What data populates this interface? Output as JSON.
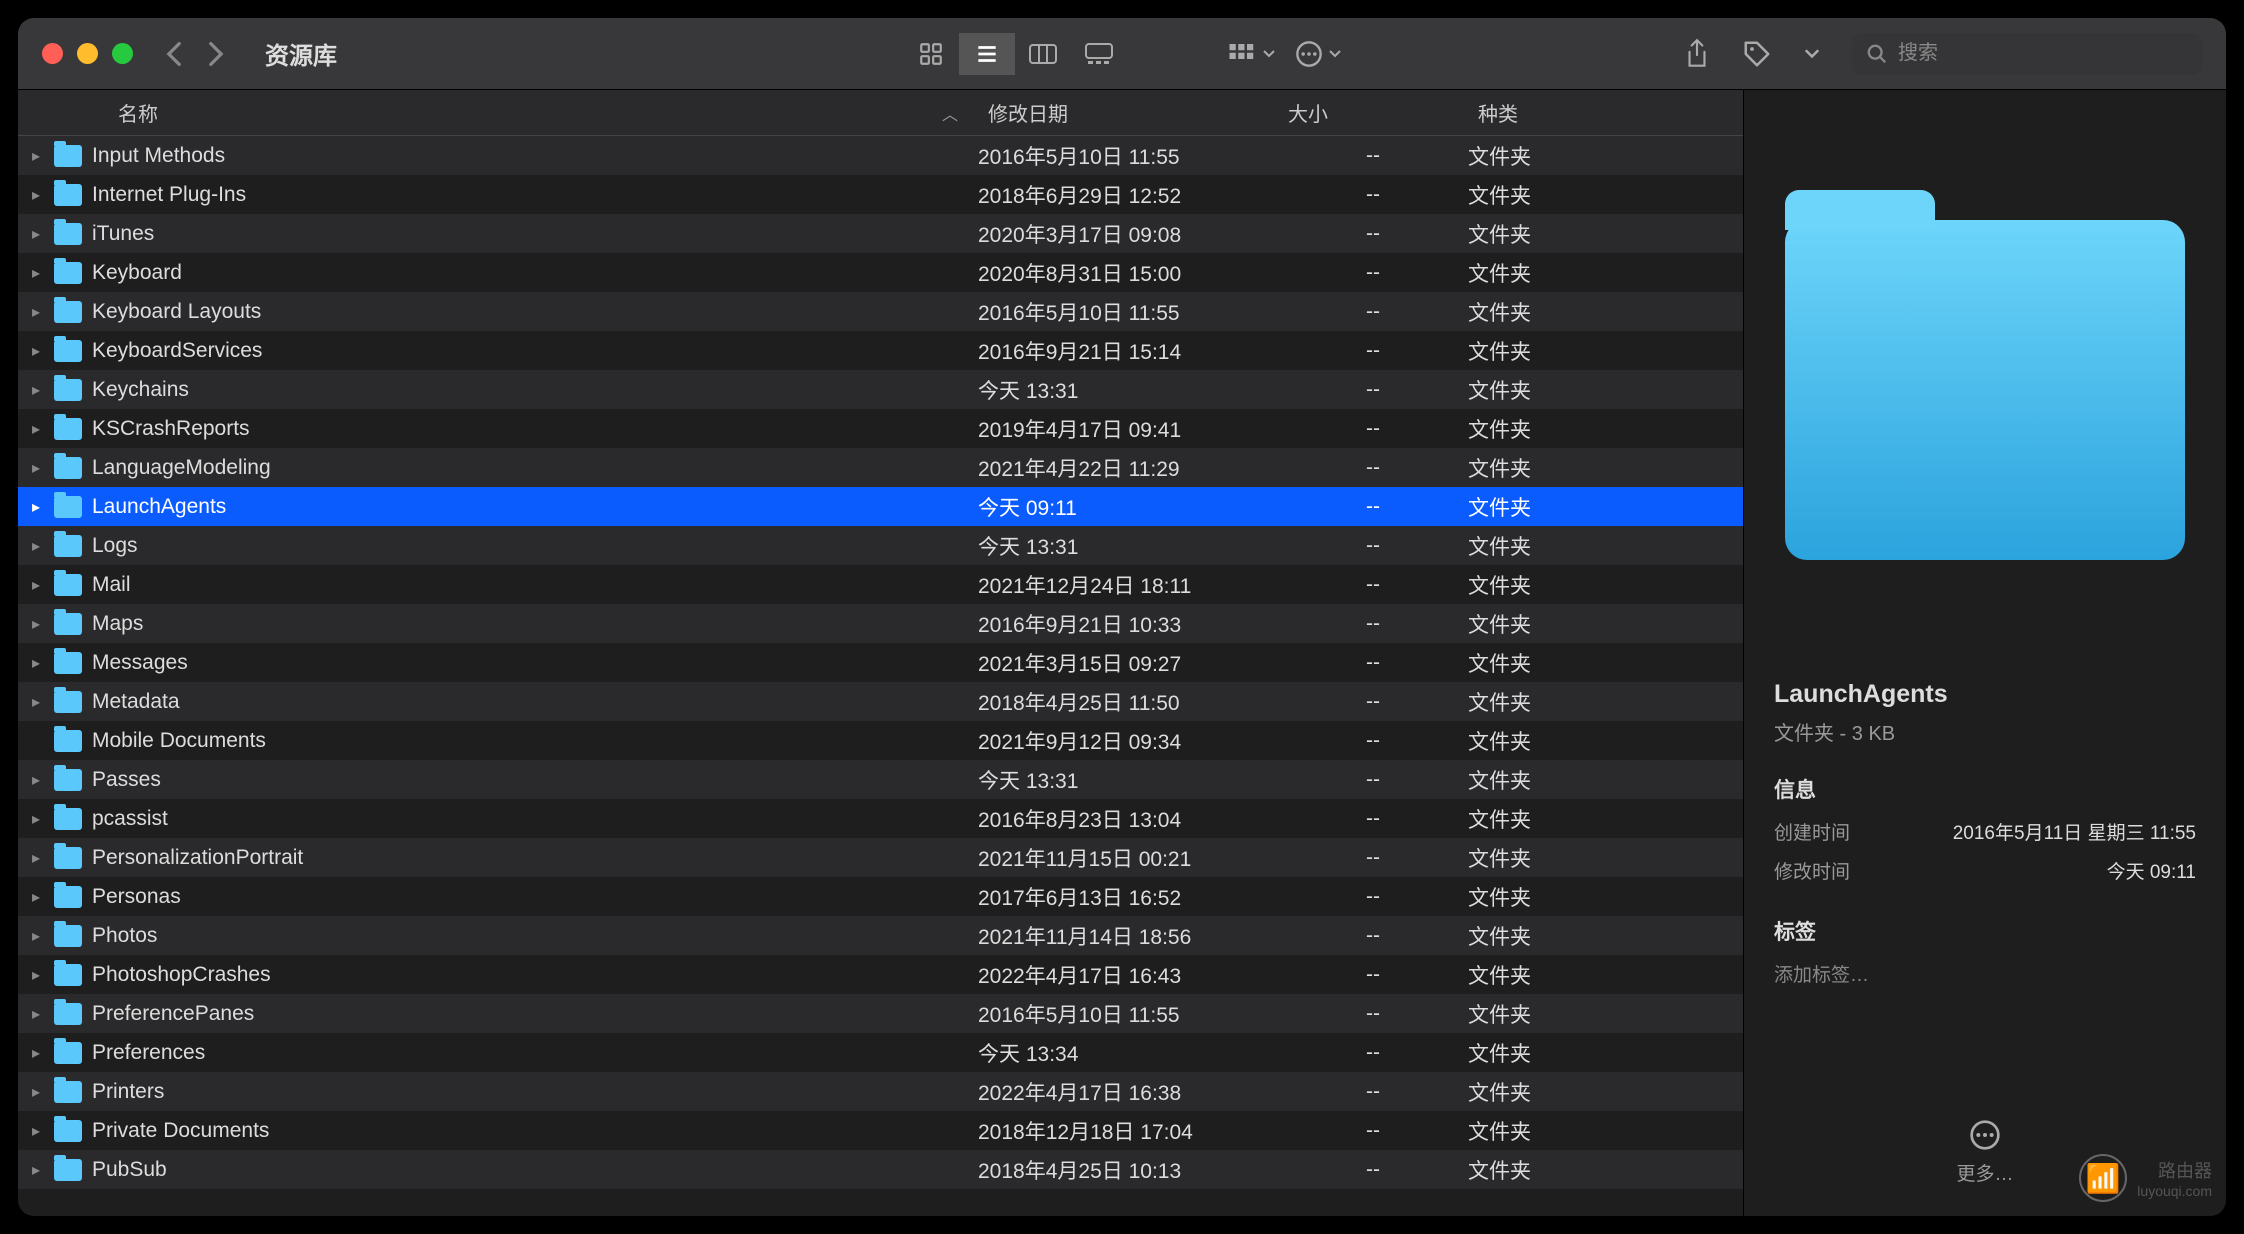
{
  "window": {
    "title": "资源库"
  },
  "search": {
    "placeholder": "搜索"
  },
  "columns": {
    "name": "名称",
    "date": "修改日期",
    "size": "大小",
    "kind": "种类"
  },
  "selected_index": 9,
  "items": [
    {
      "name": "Input Methods",
      "date": "2016年5月10日 11:55",
      "size": "--",
      "kind": "文件夹",
      "chev": true
    },
    {
      "name": "Internet Plug-Ins",
      "date": "2018年6月29日 12:52",
      "size": "--",
      "kind": "文件夹",
      "chev": true
    },
    {
      "name": "iTunes",
      "date": "2020年3月17日 09:08",
      "size": "--",
      "kind": "文件夹",
      "chev": true
    },
    {
      "name": "Keyboard",
      "date": "2020年8月31日 15:00",
      "size": "--",
      "kind": "文件夹",
      "chev": true
    },
    {
      "name": "Keyboard Layouts",
      "date": "2016年5月10日 11:55",
      "size": "--",
      "kind": "文件夹",
      "chev": true
    },
    {
      "name": "KeyboardServices",
      "date": "2016年9月21日 15:14",
      "size": "--",
      "kind": "文件夹",
      "chev": true
    },
    {
      "name": "Keychains",
      "date": "今天 13:31",
      "size": "--",
      "kind": "文件夹",
      "chev": true
    },
    {
      "name": "KSCrashReports",
      "date": "2019年4月17日 09:41",
      "size": "--",
      "kind": "文件夹",
      "chev": true
    },
    {
      "name": "LanguageModeling",
      "date": "2021年4月22日 11:29",
      "size": "--",
      "kind": "文件夹",
      "chev": true
    },
    {
      "name": "LaunchAgents",
      "date": "今天 09:11",
      "size": "--",
      "kind": "文件夹",
      "chev": true
    },
    {
      "name": "Logs",
      "date": "今天 13:31",
      "size": "--",
      "kind": "文件夹",
      "chev": true
    },
    {
      "name": "Mail",
      "date": "2021年12月24日 18:11",
      "size": "--",
      "kind": "文件夹",
      "chev": true
    },
    {
      "name": "Maps",
      "date": "2016年9月21日 10:33",
      "size": "--",
      "kind": "文件夹",
      "chev": true
    },
    {
      "name": "Messages",
      "date": "2021年3月15日 09:27",
      "size": "--",
      "kind": "文件夹",
      "chev": true
    },
    {
      "name": "Metadata",
      "date": "2018年4月25日 11:50",
      "size": "--",
      "kind": "文件夹",
      "chev": true
    },
    {
      "name": "Mobile Documents",
      "date": "2021年9月12日 09:34",
      "size": "--",
      "kind": "文件夹",
      "chev": false
    },
    {
      "name": "Passes",
      "date": "今天 13:31",
      "size": "--",
      "kind": "文件夹",
      "chev": true
    },
    {
      "name": "pcassist",
      "date": "2016年8月23日 13:04",
      "size": "--",
      "kind": "文件夹",
      "chev": true
    },
    {
      "name": "PersonalizationPortrait",
      "date": "2021年11月15日 00:21",
      "size": "--",
      "kind": "文件夹",
      "chev": true
    },
    {
      "name": "Personas",
      "date": "2017年6月13日 16:52",
      "size": "--",
      "kind": "文件夹",
      "chev": true
    },
    {
      "name": "Photos",
      "date": "2021年11月14日 18:56",
      "size": "--",
      "kind": "文件夹",
      "chev": true
    },
    {
      "name": "PhotoshopCrashes",
      "date": "2022年4月17日 16:43",
      "size": "--",
      "kind": "文件夹",
      "chev": true
    },
    {
      "name": "PreferencePanes",
      "date": "2016年5月10日 11:55",
      "size": "--",
      "kind": "文件夹",
      "chev": true
    },
    {
      "name": "Preferences",
      "date": "今天 13:34",
      "size": "--",
      "kind": "文件夹",
      "chev": true
    },
    {
      "name": "Printers",
      "date": "2022年4月17日 16:38",
      "size": "--",
      "kind": "文件夹",
      "chev": true
    },
    {
      "name": "Private Documents",
      "date": "2018年12月18日 17:04",
      "size": "--",
      "kind": "文件夹",
      "chev": true
    },
    {
      "name": "PubSub",
      "date": "2018年4月25日 10:13",
      "size": "--",
      "kind": "文件夹",
      "chev": true
    }
  ],
  "info": {
    "title": "LaunchAgents",
    "subtitle": "文件夹 - 3 KB",
    "section_info": "信息",
    "created_label": "创建时间",
    "created_value": "2016年5月11日 星期三 11:55",
    "modified_label": "修改时间",
    "modified_value": "今天 09:11",
    "section_tags": "标签",
    "tags_placeholder": "添加标签…",
    "more": "更多…"
  },
  "watermark": {
    "label": "路由器",
    "sub": "luyouqi.com"
  }
}
